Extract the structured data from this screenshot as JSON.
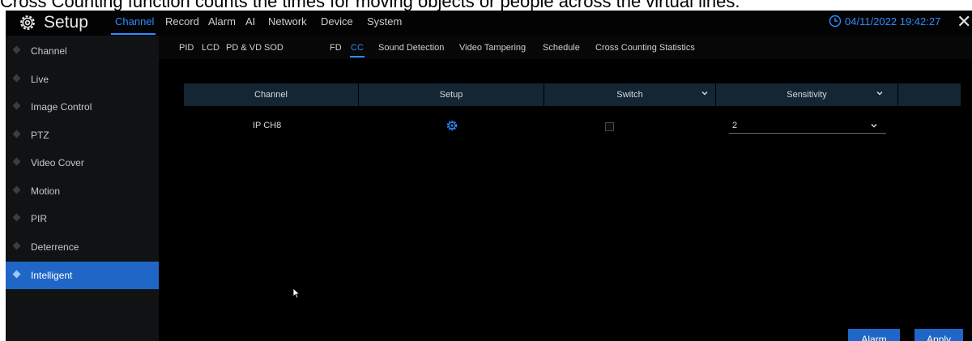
{
  "caption": "Cross Counting function counts the times for moving objects or people across the virtual lines.",
  "header": {
    "title": "Setup",
    "logo_icon": "gear-icon",
    "menu": [
      "Channel",
      "Record",
      "Alarm",
      "AI",
      "Network",
      "Device",
      "System"
    ],
    "active_menu": "Channel",
    "clock_icon": "clock-icon",
    "datetime": "04/11/2022 19:42:27",
    "close_icon": "close-icon"
  },
  "sidebar": {
    "items": [
      {
        "label": "Channel"
      },
      {
        "label": "Live"
      },
      {
        "label": "Image Control"
      },
      {
        "label": "PTZ"
      },
      {
        "label": "Video Cover"
      },
      {
        "label": "Motion"
      },
      {
        "label": "PIR"
      },
      {
        "label": "Deterrence"
      },
      {
        "label": "Intelligent"
      }
    ],
    "active": "Intelligent"
  },
  "subtabs": {
    "items": [
      "PID",
      "LCD",
      "PD & VD",
      "SOD",
      "FD",
      "CC",
      "Sound Detection",
      "Video Tampering",
      "Schedule",
      "Cross Counting Statistics"
    ],
    "active": "CC"
  },
  "table": {
    "columns": [
      "Channel",
      "Setup",
      "Switch",
      "Sensitivity"
    ],
    "rows": [
      {
        "channel": "IP CH8",
        "setup_icon": "gear-icon",
        "switch": false,
        "sensitivity": "2"
      }
    ]
  },
  "buttons": {
    "alarm": "Alarm",
    "apply": "Apply"
  },
  "colors": {
    "accent": "#2f8cff",
    "active_bg": "#1f66c6",
    "header_row_bg": "#142534",
    "sidebar_bg": "#111214",
    "app_bg": "#000000"
  }
}
